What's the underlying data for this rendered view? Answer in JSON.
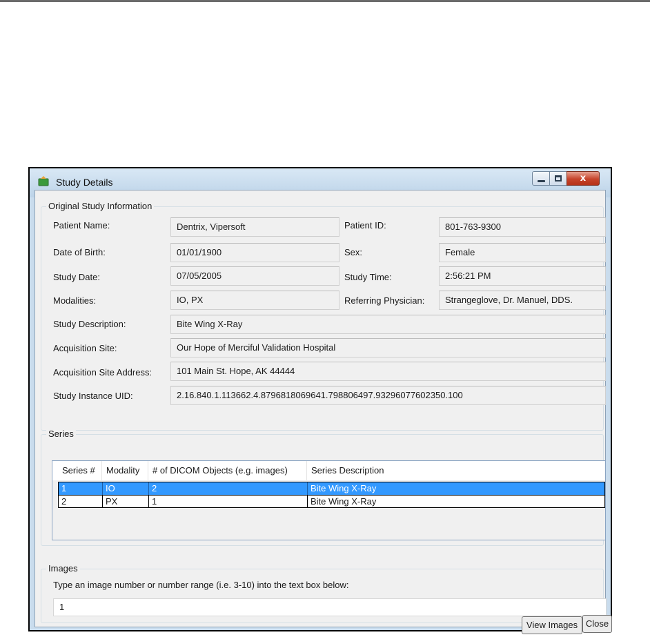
{
  "window": {
    "title": "Study Details",
    "controls": {
      "minimize": "minimize",
      "maximize": "maximize",
      "close": "x"
    }
  },
  "original": {
    "group_label": "Original Study Information",
    "patient_name": {
      "label": "Patient Name:",
      "value": "Dentrix, Vipersoft"
    },
    "patient_id": {
      "label": "Patient ID:",
      "value": "801-763-9300"
    },
    "dob": {
      "label": "Date of Birth:",
      "value": "01/01/1900"
    },
    "sex": {
      "label": "Sex:",
      "value": "Female"
    },
    "study_date": {
      "label": "Study Date:",
      "value": "07/05/2005"
    },
    "study_time": {
      "label": "Study Time:",
      "value": "2:56:21 PM"
    },
    "modalities": {
      "label": "Modalities:",
      "value": "IO, PX"
    },
    "referring": {
      "label": "Referring Physician:",
      "value": "Strangeglove, Dr. Manuel, DDS."
    },
    "description": {
      "label": "Study Description:",
      "value": "Bite Wing X-Ray"
    },
    "site": {
      "label": "Acquisition Site:",
      "value": "Our Hope of Merciful Validation Hospital"
    },
    "site_address": {
      "label": "Acquisition Site Address:",
      "value": "101 Main St. Hope, AK 44444"
    },
    "uid": {
      "label": "Study Instance UID:",
      "value": "2.16.840.1.113662.4.8796818069641.798806497.93296077602350.100"
    }
  },
  "series": {
    "group_label": "Series",
    "columns": [
      "Series #",
      "Modality",
      "# of DICOM Objects (e.g. images)",
      "Series Description"
    ],
    "rows": [
      {
        "num": "1",
        "modality": "IO",
        "objects": "2",
        "description": "Bite Wing X-Ray",
        "selected": true
      },
      {
        "num": "2",
        "modality": "PX",
        "objects": "1",
        "description": "Bite Wing X-Ray",
        "selected": false
      }
    ]
  },
  "images": {
    "group_label": "Images",
    "instruction": "Type an image number or number range (i.e. 3-10) into the text box below:",
    "input_value": "1"
  },
  "buttons": {
    "view_images": "View Images",
    "close": "Close"
  },
  "colors": {
    "selection": "#3399ff",
    "title_bar": "#c9dced",
    "dialog_bg": "#f0f0f0"
  }
}
